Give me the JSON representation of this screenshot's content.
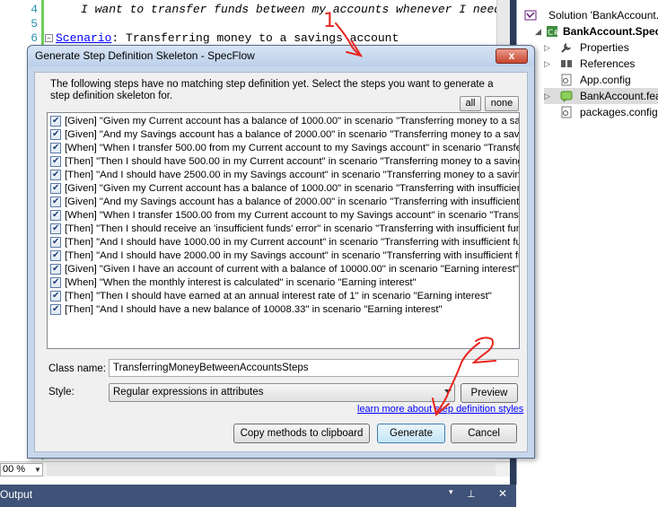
{
  "editor": {
    "line_numbers": [
      "4",
      "5",
      "6"
    ],
    "line4_text": "I want to transfer funds between my accounts whenever I need to",
    "line6_keyword": "Scenario",
    "line6_text": ": Transferring money to a savings account",
    "zoom": "00 %"
  },
  "solution_explorer": {
    "items": [
      {
        "label": "Solution 'BankAccount.",
        "icon": "solution-icon"
      },
      {
        "label": "BankAccount.Specs",
        "icon": "csharp-project-icon"
      },
      {
        "label": "Properties",
        "icon": "wrench-icon"
      },
      {
        "label": "References",
        "icon": "references-icon"
      },
      {
        "label": "App.config",
        "icon": "config-file-icon"
      },
      {
        "label": "BankAccount.fea",
        "icon": "feature-file-icon"
      },
      {
        "label": "packages.config",
        "icon": "config-file-icon"
      }
    ]
  },
  "output_panel": {
    "title": "Output",
    "pin_glyph": "⊥",
    "close_glyph": "✕",
    "dropdown_glyph": "▾"
  },
  "dialog": {
    "title": "Generate Step Definition Skeleton - SpecFlow",
    "close_glyph": "x",
    "intro": "The following steps have no matching step definition yet. Select the steps you want to generate a step definition skeleton for.",
    "all_label": "all",
    "none_label": "none",
    "steps": [
      "[Given] \"Given my Current account has a balance of 1000.00\" in scenario \"Transferring money to a savings account\"",
      "[Given] \"And my Savings account has a balance of 2000.00\" in scenario \"Transferring money to a savings account\"",
      "[When] \"When I transfer 500.00 from my Current account to my Savings account\" in scenario \"Transferring money to a savings account\"",
      "[Then] \"Then I should have 500.00 in my Current account\" in scenario \"Transferring money to a savings account\"",
      "[Then] \"And I should have 2500.00 in my Savings account\" in scenario \"Transferring money to a savings account\"",
      "[Given] \"Given my Current account has a balance of 1000.00\" in scenario \"Transferring with insufficient funds\"",
      "[Given] \"And my Savings account has a balance of 2000.00\" in scenario \"Transferring with insufficient funds\"",
      "[When] \"When I transfer 1500.00 from my Current account to my Savings account\" in scenario \"Transferring with insufficient funds\"",
      "[Then] \"Then I should receive an 'insufficient funds' error\" in scenario \"Transferring with insufficient funds\"",
      "[Then] \"And I should have 1000.00 in my Current account\" in scenario \"Transferring with insufficient funds\"",
      "[Then] \"And I should have 2000.00 in my Savings account\" in scenario \"Transferring with insufficient funds\"",
      "[Given] \"Given I have an account of current with a balance of 10000.00\" in scenario \"Earning interest\"",
      "[When] \"When the monthly interest is calculated\" in scenario \"Earning interest\"",
      "[Then] \"Then I should have earned at an annual interest rate of 1\" in scenario \"Earning interest\"",
      "[Then] \"And I should have a new balance of 10008.33\" in scenario \"Earning interest\""
    ],
    "class_name_label": "Class name:",
    "class_name_value": "TransferringMoneyBetweenAccountsSteps",
    "style_label": "Style:",
    "style_value": "Regular expressions in attributes",
    "preview_label": "Preview",
    "learn_more_link": "learn more about step definition styles",
    "copy_label": "Copy methods to clipboard",
    "generate_label": "Generate",
    "cancel_label": "Cancel"
  },
  "annotations": {
    "marker1": "1",
    "marker2": "2",
    "color": "#e8261f"
  }
}
